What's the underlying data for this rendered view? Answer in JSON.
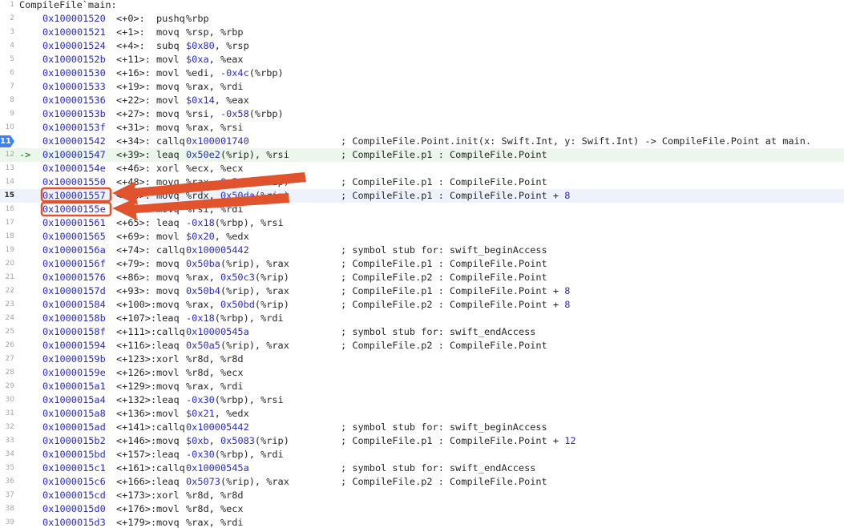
{
  "title": "CompileFile`main:",
  "current_line": 15,
  "lines": [
    {
      "n": "1",
      "pc": false,
      "addr": "",
      "off": "",
      "mn": "",
      "ops": "",
      "cmt": "",
      "raw": "CompileFile`main:"
    },
    {
      "n": "2",
      "addr": "0x100001520",
      "off": "<+0>:",
      "mn": "pushq",
      "ops": "%rbp",
      "cmt": ""
    },
    {
      "n": "3",
      "addr": "0x100001521",
      "off": "<+1>:",
      "mn": "movq",
      "ops": "%rsp, %rbp",
      "cmt": ""
    },
    {
      "n": "4",
      "addr": "0x100001524",
      "off": "<+4>:",
      "mn": "subq",
      "ops": "$0x80, %rsp",
      "cmt": ""
    },
    {
      "n": "5",
      "addr": "0x10000152b",
      "off": "<+11>:",
      "mn": "movl",
      "ops": "$0xa, %eax",
      "cmt": ""
    },
    {
      "n": "6",
      "addr": "0x100001530",
      "off": "<+16>:",
      "mn": "movl",
      "ops": "%edi, -0x4c(%rbp)",
      "cmt": ""
    },
    {
      "n": "7",
      "addr": "0x100001533",
      "off": "<+19>:",
      "mn": "movq",
      "ops": "%rax, %rdi",
      "cmt": ""
    },
    {
      "n": "8",
      "addr": "0x100001536",
      "off": "<+22>:",
      "mn": "movl",
      "ops": "$0x14, %eax",
      "cmt": ""
    },
    {
      "n": "9",
      "addr": "0x10000153b",
      "off": "<+27>:",
      "mn": "movq",
      "ops": "%rsi, -0x58(%rbp)",
      "cmt": ""
    },
    {
      "n": "10",
      "addr": "0x10000153f",
      "off": "<+31>:",
      "mn": "movq",
      "ops": "%rax, %rsi",
      "cmt": ""
    },
    {
      "n": "11",
      "bp": true,
      "addr": "0x100001542",
      "off": "<+34>:",
      "mn": "callq",
      "ops": "0x100001740",
      "cmt": "; CompileFile.Point.init(x: Swift.Int, y: Swift.Int) -> CompileFile.Point at main."
    },
    {
      "n": "12",
      "pc": true,
      "addr": "0x100001547",
      "off": "<+39>:",
      "mn": "leaq",
      "ops": "0x50e2(%rip), %rsi",
      "cmt": "; CompileFile.p1 : CompileFile.Point"
    },
    {
      "n": "13",
      "addr": "0x10000154e",
      "off": "<+46>:",
      "mn": "xorl",
      "ops": "%ecx, %ecx",
      "cmt": ""
    },
    {
      "n": "14",
      "addr": "0x100001550",
      "off": "<+48>:",
      "mn": "movq",
      "ops": "%rax, 0x50d9(%rip)",
      "cmt": "; CompileFile.p1 : CompileFile.Point"
    },
    {
      "n": "15",
      "cur": true,
      "addr": "0x100001557",
      "off": "<+55>:",
      "mn": "movq",
      "ops": "%rdx, 0x50da(%rip)",
      "cmt": "; CompileFile.p1 : CompileFile.Point + 8"
    },
    {
      "n": "16",
      "addr": "0x10000155e",
      "off": "<+62>:",
      "mn": "movq",
      "ops": "%rsi, %rdi",
      "cmt": ""
    },
    {
      "n": "17",
      "addr": "0x100001561",
      "off": "<+65>:",
      "mn": "leaq",
      "ops": "-0x18(%rbp), %rsi",
      "cmt": ""
    },
    {
      "n": "18",
      "addr": "0x100001565",
      "off": "<+69>:",
      "mn": "movl",
      "ops": "$0x20, %edx",
      "cmt": ""
    },
    {
      "n": "19",
      "addr": "0x10000156a",
      "off": "<+74>:",
      "mn": "callq",
      "ops": "0x100005442",
      "cmt": "; symbol stub for: swift_beginAccess"
    },
    {
      "n": "20",
      "addr": "0x10000156f",
      "off": "<+79>:",
      "mn": "movq",
      "ops": "0x50ba(%rip), %rax",
      "cmt": "; CompileFile.p1 : CompileFile.Point"
    },
    {
      "n": "21",
      "addr": "0x100001576",
      "off": "<+86>:",
      "mn": "movq",
      "ops": "%rax, 0x50c3(%rip)",
      "cmt": "; CompileFile.p2 : CompileFile.Point"
    },
    {
      "n": "22",
      "addr": "0x10000157d",
      "off": "<+93>:",
      "mn": "movq",
      "ops": "0x50b4(%rip), %rax",
      "cmt": "; CompileFile.p1 : CompileFile.Point + 8"
    },
    {
      "n": "23",
      "addr": "0x100001584",
      "off": "<+100>:",
      "mn": "movq",
      "ops": "%rax, 0x50bd(%rip)",
      "cmt": "; CompileFile.p2 : CompileFile.Point + 8"
    },
    {
      "n": "24",
      "addr": "0x10000158b",
      "off": "<+107>:",
      "mn": "leaq",
      "ops": "-0x18(%rbp), %rdi",
      "cmt": ""
    },
    {
      "n": "25",
      "addr": "0x10000158f",
      "off": "<+111>:",
      "mn": "callq",
      "ops": "0x10000545a",
      "cmt": "; symbol stub for: swift_endAccess"
    },
    {
      "n": "26",
      "addr": "0x100001594",
      "off": "<+116>:",
      "mn": "leaq",
      "ops": "0x50a5(%rip), %rax",
      "cmt": "; CompileFile.p2 : CompileFile.Point"
    },
    {
      "n": "27",
      "addr": "0x10000159b",
      "off": "<+123>:",
      "mn": "xorl",
      "ops": "%r8d, %r8d",
      "cmt": ""
    },
    {
      "n": "28",
      "addr": "0x10000159e",
      "off": "<+126>:",
      "mn": "movl",
      "ops": "%r8d, %ecx",
      "cmt": ""
    },
    {
      "n": "29",
      "addr": "0x1000015a1",
      "off": "<+129>:",
      "mn": "movq",
      "ops": "%rax, %rdi",
      "cmt": ""
    },
    {
      "n": "30",
      "addr": "0x1000015a4",
      "off": "<+132>:",
      "mn": "leaq",
      "ops": "-0x30(%rbp), %rsi",
      "cmt": ""
    },
    {
      "n": "31",
      "addr": "0x1000015a8",
      "off": "<+136>:",
      "mn": "movl",
      "ops": "$0x21, %edx",
      "cmt": ""
    },
    {
      "n": "32",
      "addr": "0x1000015ad",
      "off": "<+141>:",
      "mn": "callq",
      "ops": "0x100005442",
      "cmt": "; symbol stub for: swift_beginAccess"
    },
    {
      "n": "33",
      "addr": "0x1000015b2",
      "off": "<+146>:",
      "mn": "movq",
      "ops": "$0xb, 0x5083(%rip)",
      "cmt": "; CompileFile.p1 : CompileFile.Point + 12"
    },
    {
      "n": "34",
      "addr": "0x1000015bd",
      "off": "<+157>:",
      "mn": "leaq",
      "ops": "-0x30(%rbp), %rdi",
      "cmt": ""
    },
    {
      "n": "35",
      "addr": "0x1000015c1",
      "off": "<+161>:",
      "mn": "callq",
      "ops": "0x10000545a",
      "cmt": "; symbol stub for: swift_endAccess"
    },
    {
      "n": "36",
      "addr": "0x1000015c6",
      "off": "<+166>:",
      "mn": "leaq",
      "ops": "0x5073(%rip), %rax",
      "cmt": "; CompileFile.p2 : CompileFile.Point"
    },
    {
      "n": "37",
      "addr": "0x1000015cd",
      "off": "<+173>:",
      "mn": "xorl",
      "ops": "%r8d, %r8d",
      "cmt": ""
    },
    {
      "n": "38",
      "addr": "0x1000015d0",
      "off": "<+176>:",
      "mn": "movl",
      "ops": "%r8d, %ecx",
      "cmt": ""
    },
    {
      "n": "39",
      "addr": "0x1000015d3",
      "off": "<+179>:",
      "mn": "movq",
      "ops": "%rax, %rdi",
      "cmt": ""
    }
  ],
  "pc_marker": "->",
  "annotations": {
    "highlight_color": "#e0532c",
    "boxed_addresses": [
      "0x100001557",
      "0x10000155e"
    ]
  }
}
